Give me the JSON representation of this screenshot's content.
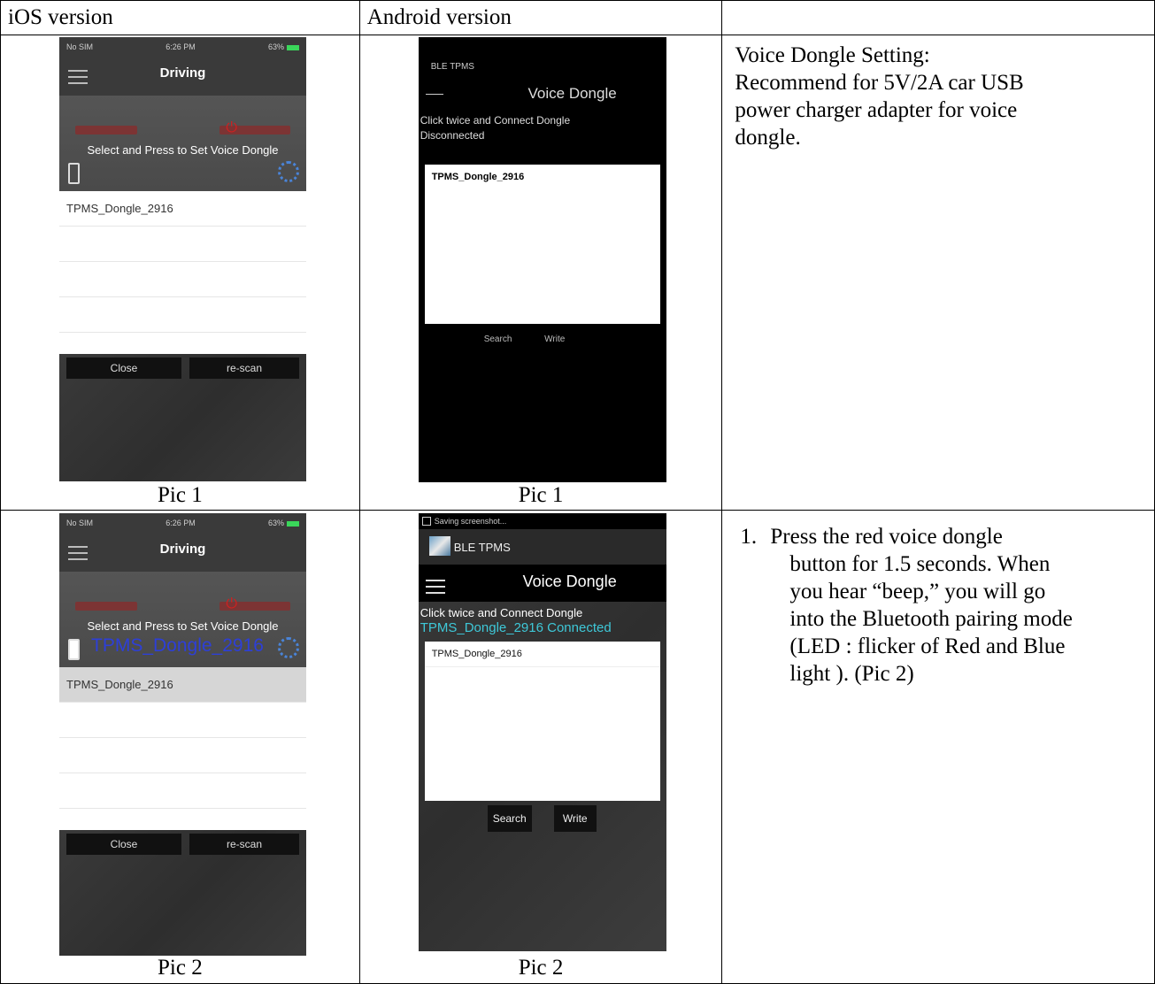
{
  "headers": [
    "iOS version",
    "Android version",
    ""
  ],
  "captions": {
    "pic1": "Pic 1",
    "pic2": "Pic 2"
  },
  "ios": {
    "status_left": "No SIM",
    "status_time": "6:26 PM",
    "status_right": "63%",
    "nav_title": "Driving",
    "select_text": "Select and Press to Set Voice Dongle",
    "device_name": "TPMS_Dongle_2916",
    "close_label": "Close",
    "rescan_label": "re-scan"
  },
  "android1": {
    "app_label": "BLE TPMS",
    "title": "Voice Dongle",
    "instruction": "Click twice and Connect Dongle",
    "status": "Disconnected",
    "device_name": "TPMS_Dongle_2916",
    "search_label": "Search",
    "write_label": "Write"
  },
  "android2": {
    "notification": "Saving screenshot...",
    "app_label": "BLE TPMS",
    "title": "Voice Dongle",
    "instruction": "Click twice and Connect Dongle",
    "status": "TPMS_Dongle_2916 Connected",
    "device_name": "TPMS_Dongle_2916",
    "search_label": "Search",
    "write_label": "Write"
  },
  "right": {
    "voice_setting_title": "Voice Dongle Setting:",
    "voice_setting_lines": [
      "Recommend for 5V/2A  car USB",
      "power charger adapter for voice",
      "dongle."
    ],
    "step1_number": "1.",
    "step1_lines": [
      "Press the red voice dongle",
      "button for 1.5 seconds. When",
      "you hear “beep,” you will go",
      "into the Bluetooth pairing mode",
      "(LED : flicker of Red and Blue",
      "light ). (Pic 2)"
    ]
  }
}
